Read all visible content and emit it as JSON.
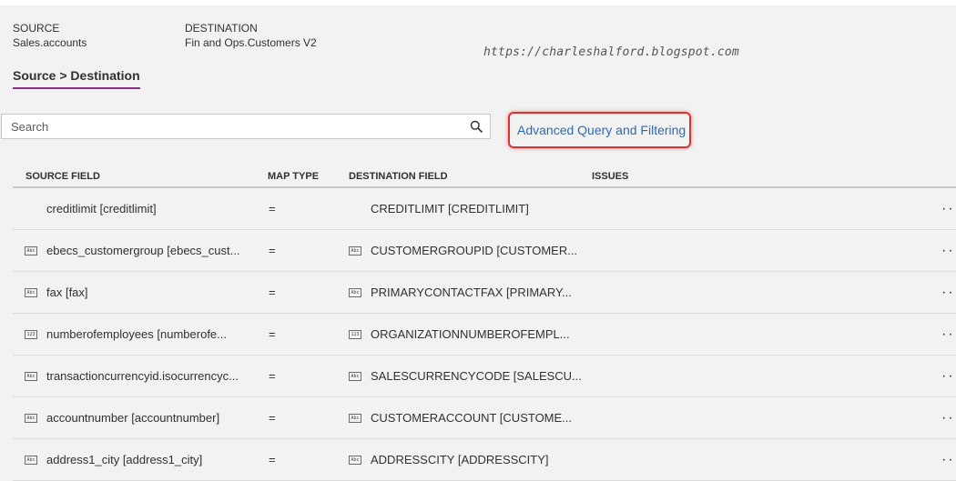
{
  "header": {
    "source_label": "SOURCE",
    "source_value": "Sales.accounts",
    "destination_label": "DESTINATION",
    "destination_value": "Fin and Ops.Customers V2"
  },
  "watermark": "https://charleshalford.blogspot.com",
  "breadcrumb": "Source > Destination",
  "search": {
    "placeholder": "Search",
    "value": ""
  },
  "advanced_query": "Advanced Query and Filtering",
  "columns": {
    "source": "SOURCE FIELD",
    "map": "MAP TYPE",
    "destination": "DESTINATION FIELD",
    "issues": "ISSUES"
  },
  "rows": [
    {
      "src_icon": "",
      "source": "creditlimit [creditlimit]",
      "map": "=",
      "dst_icon": "",
      "destination": "CREDITLIMIT [CREDITLIMIT]"
    },
    {
      "src_icon": "Abc",
      "source": "ebecs_customergroup [ebecs_cust...",
      "map": "=",
      "dst_icon": "Abc",
      "destination": "CUSTOMERGROUPID [CUSTOMER..."
    },
    {
      "src_icon": "Abc",
      "source": "fax [fax]",
      "map": "=",
      "dst_icon": "Abc",
      "destination": "PRIMARYCONTACTFAX [PRIMARY..."
    },
    {
      "src_icon": "123",
      "source": "numberofemployees [numberofe...",
      "map": "=",
      "dst_icon": "123",
      "destination": "ORGANIZATIONNUMBEROFEMPL..."
    },
    {
      "src_icon": "Abc",
      "source": "transactioncurrencyid.isocurrencyc...",
      "map": "=",
      "dst_icon": "Abc",
      "destination": "SALESCURRENCYCODE [SALESCU..."
    },
    {
      "src_icon": "Abc",
      "source": "accountnumber [accountnumber]",
      "map": "=",
      "dst_icon": "Abc",
      "destination": "CUSTOMERACCOUNT [CUSTOME..."
    },
    {
      "src_icon": "Abc",
      "source": "address1_city [address1_city]",
      "map": "=",
      "dst_icon": "Abc",
      "destination": "ADDRESSCITY [ADDRESSCITY]"
    }
  ],
  "more_glyph": "···",
  "icons": {
    "search": "search-icon",
    "more": "more-icon",
    "text_type": "text-type-icon",
    "number_type": "number-type-icon"
  }
}
